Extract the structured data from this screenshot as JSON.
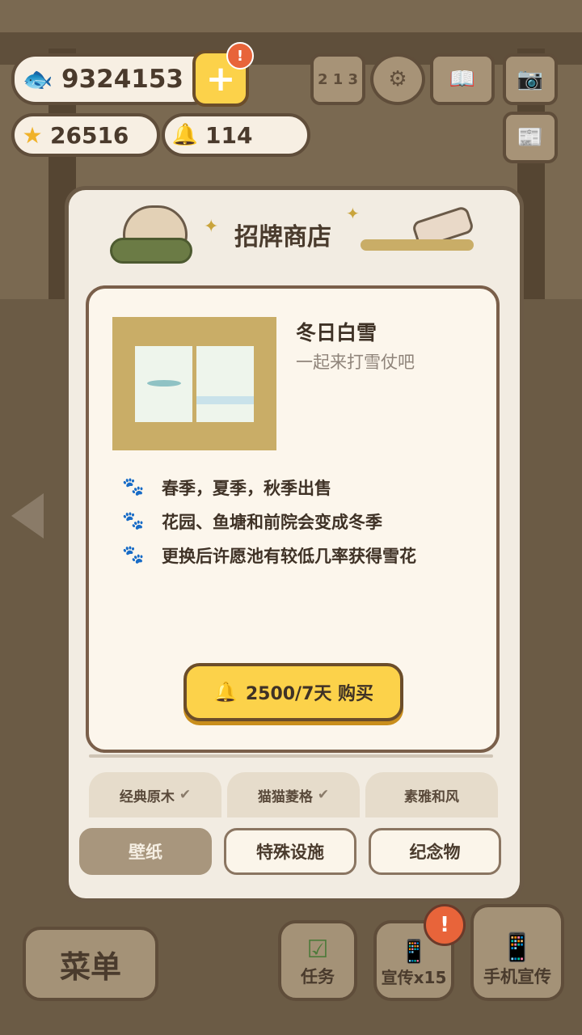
{
  "hud": {
    "fish_count": "9324153",
    "star_count": "26516",
    "bell_count": "114",
    "notify_badge": "!"
  },
  "dialog": {
    "title": "招牌商店",
    "item": {
      "name": "冬日白雪",
      "subtitle": "一起来打雪仗吧",
      "features": [
        "春季，夏季，秋季出售",
        "花园、鱼塘和前院会变成冬季",
        "更换后许愿池有较低几率获得雪花"
      ],
      "buy_label": "2500/7天  购买"
    },
    "style_tabs": [
      "经典原木",
      "猫猫菱格",
      "素雅和风"
    ],
    "categories": [
      "壁纸",
      "特殊设施",
      "纪念物"
    ],
    "active_category": "壁纸"
  },
  "bottom": {
    "menu_label": "菜单",
    "task_label": "任务",
    "promo_label": "宣传x15",
    "phone_promo_label": "手机宣传",
    "promo_badge": "!"
  },
  "colors": {
    "accent_yellow": "#fcd24a",
    "panel": "#f2ece2",
    "card": "#fcf6ec",
    "dark_outline": "#5f4d3a"
  }
}
